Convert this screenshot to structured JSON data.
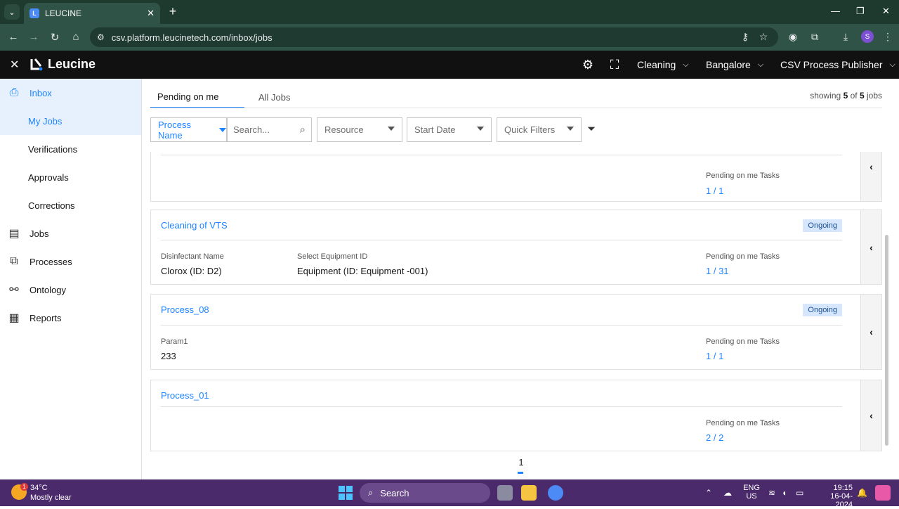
{
  "browser": {
    "tab_title": "LEUCINE",
    "url": "csv.platform.leucinetech.com/inbox/jobs",
    "profile_initial": "S"
  },
  "header": {
    "brand": "Leucine",
    "use_case": "Cleaning",
    "facility": "Bangalore",
    "role": "CSV Process Publisher"
  },
  "sidebar": {
    "items": [
      {
        "label": "Inbox",
        "icon": "inbox-icon"
      },
      {
        "label": "My Jobs"
      },
      {
        "label": "Verifications"
      },
      {
        "label": "Approvals"
      },
      {
        "label": "Corrections"
      },
      {
        "label": "Jobs",
        "icon": "clipboard-icon"
      },
      {
        "label": "Processes",
        "icon": "process-icon"
      },
      {
        "label": "Ontology",
        "icon": "hierarchy-icon"
      },
      {
        "label": "Reports",
        "icon": "report-icon"
      }
    ]
  },
  "main": {
    "tabs": [
      "Pending on me",
      "All Jobs"
    ],
    "showing_prefix": "showing ",
    "showing_count": "5",
    "showing_of": " of ",
    "showing_total": "5",
    "showing_suffix": " jobs",
    "filters": {
      "process_name": "Process Name",
      "search_placeholder": "Search...",
      "resource": "Resource",
      "start_date": "Start Date",
      "quick_filters": "Quick Filters"
    },
    "jobs": [
      {
        "name": "",
        "badge": "",
        "tasks_label": "Pending on me Tasks",
        "tasks": "1 / 1",
        "params": []
      },
      {
        "name": "Cleaning of VTS",
        "badge": "Ongoing",
        "tasks_label": "Pending on me Tasks",
        "tasks": "1 / 31",
        "params": [
          {
            "label": "Disinfectant Name",
            "value": "Clorox (ID: D2)"
          },
          {
            "label": "Select Equipment ID",
            "value": "Equipment (ID: Equipment -001)"
          }
        ]
      },
      {
        "name": "Process_08",
        "badge": "Ongoing",
        "tasks_label": "Pending on me Tasks",
        "tasks": "1 / 1",
        "params": [
          {
            "label": "Param1",
            "value": "233"
          }
        ]
      },
      {
        "name": "Process_01",
        "badge": "",
        "tasks_label": "Pending on me Tasks",
        "tasks": "2 / 2",
        "params": []
      }
    ],
    "page": "1"
  },
  "taskbar": {
    "temperature": "34°C",
    "weather": "Mostly clear",
    "weather_badge": "1",
    "search": "Search",
    "lang_1": "ENG",
    "lang_2": "US",
    "time": "19:15",
    "date": "16-04-2024"
  }
}
